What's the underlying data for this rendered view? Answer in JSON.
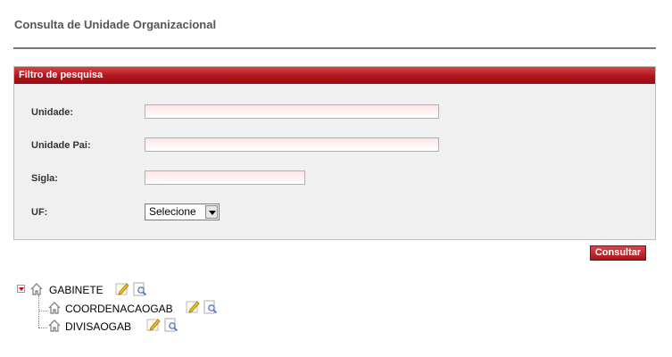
{
  "header": {
    "title": "Consulta de Unidade Organizacional"
  },
  "filter": {
    "title": "Filtro de pesquisa",
    "unidade_label": "Unidade:",
    "unidade_value": "",
    "unidade_pai_label": "Unidade Pai:",
    "unidade_pai_value": "",
    "sigla_label": "Sigla:",
    "sigla_value": "",
    "uf_label": "UF:",
    "uf_selected": "Selecione",
    "submit_label": "Consultar"
  },
  "tree": {
    "root": {
      "label": "GABINETE",
      "icon": "home-icon",
      "expanded": true
    },
    "children": [
      {
        "label": "COORDENACAOGAB",
        "icon": "home-icon"
      },
      {
        "label": "DIVISAOGAB",
        "icon": "home-icon"
      }
    ],
    "actions": [
      "edit-icon",
      "view-icon"
    ]
  },
  "colors": {
    "accent": "#b3141b",
    "panel_bg": "#f0f0f0",
    "input_tint": "#ffe4e4"
  }
}
